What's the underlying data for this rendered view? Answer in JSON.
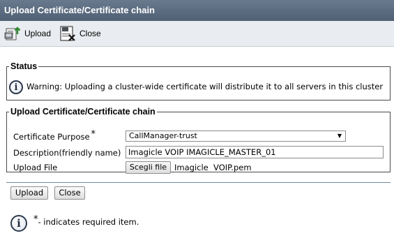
{
  "window": {
    "title": "Upload Certificate/Certificate chain"
  },
  "toolbar": {
    "upload_label": "Upload",
    "close_label": "Close"
  },
  "status": {
    "legend": "Status",
    "message": "Warning: Uploading a cluster-wide certificate will distribute it to all servers in this cluster"
  },
  "form": {
    "legend": "Upload Certificate/Certificate chain",
    "purpose_label": "Certificate Purpose",
    "required_mark": "*",
    "purpose_value": "CallManager-trust",
    "description_label": "Description(friendly name)",
    "description_value": "Imagicle VOIP IMAGICLE_MASTER_01",
    "file_label": "Upload File",
    "file_button": "Scegli file",
    "file_name": "Imagicle  VOIP.pem"
  },
  "actions": {
    "upload_label": "Upload",
    "close_label": "Close"
  },
  "footnote": {
    "star": "*",
    "text": "- indicates required item."
  },
  "colors": {
    "title_bar": "#55657a",
    "toolbar_bg": "#e9ecf0",
    "separator": "#6e8aa0"
  }
}
